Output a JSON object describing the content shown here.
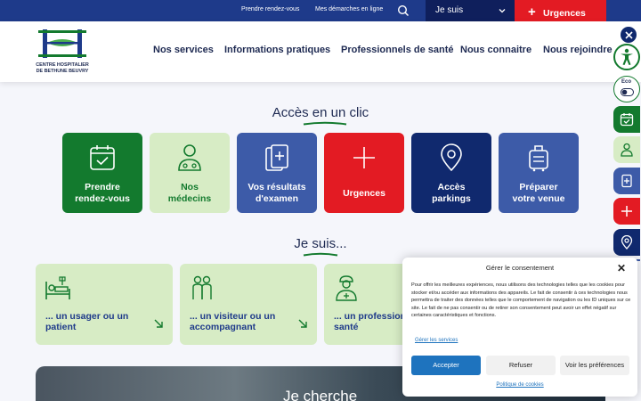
{
  "topbar": {
    "link_rdv": "Prendre rendez-vous",
    "link_demarches": "Mes démarches en ligne",
    "jesuis_label": "Je suis",
    "urgences_label": "Urgences"
  },
  "logo": {
    "line1": "CENTRE HOSPITALIER",
    "line2": "DE BETHUNE BEUVRY"
  },
  "nav": {
    "items": [
      "Nos services",
      "Informations pratiques",
      "Professionnels de santé",
      "Nous connaitre",
      "Nous rejoindre"
    ]
  },
  "side": {
    "eco_label": "Eco"
  },
  "acces": {
    "title": "Accès en un clic",
    "tiles": [
      {
        "line1": "Prendre",
        "line2": "rendez-vous",
        "icon": "calendar-icon"
      },
      {
        "line1": "Nos",
        "line2": "médecins",
        "icon": "doctor-icon"
      },
      {
        "line1": "Vos résultats",
        "line2": "d'examen",
        "icon": "results-icon"
      },
      {
        "line1": "Urgences",
        "line2": "",
        "icon": "plus-icon"
      },
      {
        "line1": "Accès",
        "line2": "parkings",
        "icon": "location-pin-icon"
      },
      {
        "line1": "Préparer",
        "line2": "votre venue",
        "icon": "suitcase-icon"
      }
    ],
    "colors": {
      "green_dark": "#137a2e",
      "green_light": "#d7ecc5",
      "blue_mid": "#3d5ba8",
      "red": "#e31b23",
      "navy": "#10296e"
    }
  },
  "jesuis": {
    "title": "Je suis...",
    "cards": [
      {
        "line1": "... un usager ou un",
        "line2": "patient",
        "icon": "hospital-bed-icon"
      },
      {
        "line1": "... un visiteur ou un",
        "line2": "accompagnant",
        "icon": "visitors-icon"
      },
      {
        "line1": "... un professionn",
        "line2": "santé",
        "icon": "nurse-icon"
      }
    ]
  },
  "banner": {
    "title": "Je cherche"
  },
  "consent": {
    "title": "Gérer le consentement",
    "text": "Pour offrir les meilleures expériences, nous utilisons des technologies telles que les cookies pour stocker et/ou accéder aux informations des appareils. Le fait de consentir à ces technologies nous permettra de traiter des données telles que le comportement de navigation ou les ID uniques sur ce site. Le fait de ne pas consentir ou de retirer son consentement peut avoir un effet négatif sur certaines caractéristiques et fonctions.",
    "manage_link": "Gérer les services",
    "accept": "Accepter",
    "refuse": "Refuser",
    "prefs": "Voir les préférences",
    "policy": "Politique de cookies",
    "accept_color": "#1e73be"
  }
}
